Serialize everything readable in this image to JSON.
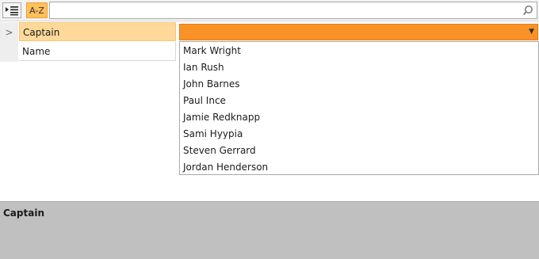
{
  "toolbar": {
    "categorized_icon": "categorized-list-icon",
    "alphabetical_label": "A-Z",
    "search_placeholder": "",
    "search_icon": "search-icon"
  },
  "property_grid": {
    "rows": [
      {
        "name": "Captain",
        "selected": true
      },
      {
        "name": "Name",
        "selected": false
      }
    ],
    "expander_glyph": ">"
  },
  "combo": {
    "value": "",
    "options": [
      "Mark Wright",
      "Ian Rush",
      "John Barnes",
      "Paul Ince",
      "Jamie Redknapp",
      "Sami Hyypia",
      "Steven Gerrard",
      "Jordan Henderson"
    ]
  },
  "description": {
    "title": "Captain"
  },
  "colors": {
    "combo_fill": "#fb9228",
    "selected_row": "#ffd99a",
    "az_button": "#ffc05a",
    "description_bg": "#c0c0c0"
  }
}
